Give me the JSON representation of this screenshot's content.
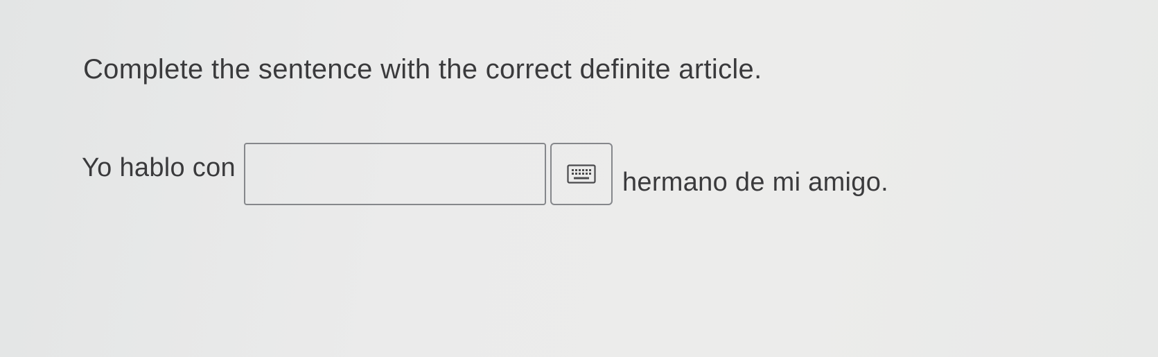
{
  "question": {
    "instruction": "Complete the sentence with the correct definite article.",
    "sentence_before": "Yo hablo con",
    "sentence_after": "hermano de mi amigo.",
    "answer_value": "",
    "answer_placeholder": ""
  },
  "keyboard_button": {
    "icon": "keyboard-icon"
  }
}
